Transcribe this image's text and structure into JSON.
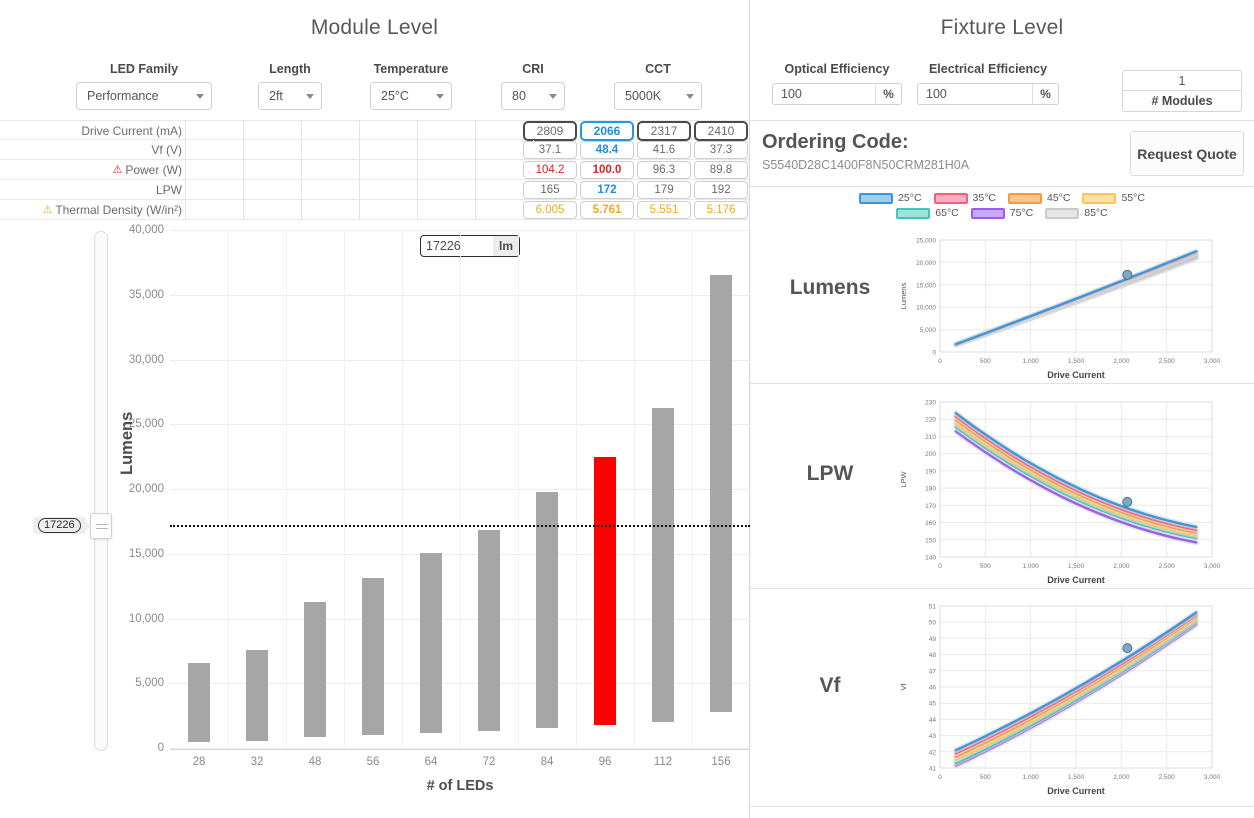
{
  "module": {
    "title": "Module Level",
    "selectors": [
      {
        "name": "led-family",
        "label": "LED Family",
        "value": "Performance"
      },
      {
        "name": "length",
        "label": "Length",
        "value": "2ft"
      },
      {
        "name": "temperature",
        "label": "Temperature",
        "value": "25°C"
      },
      {
        "name": "cri",
        "label": "CRI",
        "value": "80"
      },
      {
        "name": "cct",
        "label": "CCT",
        "value": "5000K"
      }
    ],
    "table": {
      "rows": [
        {
          "label": "Drive Current (mA)",
          "warn": null,
          "values": [
            "2809",
            "2066",
            "2317",
            "2410"
          ]
        },
        {
          "label": "Vf (V)",
          "warn": null,
          "values": [
            "37.1",
            "48.4",
            "41.6",
            "37.3"
          ]
        },
        {
          "label": "Power (W)",
          "warn": "red",
          "values": [
            "104.2",
            "100.0",
            "96.3",
            "89.8"
          ]
        },
        {
          "label": "LPW",
          "warn": null,
          "values": [
            "165",
            "172",
            "179",
            "192"
          ]
        },
        {
          "label": "Thermal Density (W/in²)",
          "warn": "orange",
          "values": [
            "6.005",
            "5.761",
            "5.551",
            "5.176"
          ]
        }
      ],
      "selected_column": 1
    },
    "slider": {
      "value": "17226"
    },
    "lumen_input": {
      "value": "17226",
      "unit": "lm"
    }
  },
  "fixture": {
    "title": "Fixture Level",
    "optical_efficiency": {
      "label": "Optical Efficiency",
      "value": "100",
      "unit": "%"
    },
    "electrical_efficiency": {
      "label": "Electrical Efficiency",
      "value": "100",
      "unit": "%"
    },
    "modules": {
      "value": "1",
      "label": "# Modules"
    },
    "ordering": {
      "title": "Ordering Code:",
      "code": "S5540D28C1400F8N50CRM281H0A"
    },
    "quote_button": "Request Quote",
    "legend": [
      {
        "label": "25°C",
        "color": "#3a97dd",
        "fill": "#9ccef2"
      },
      {
        "label": "35°C",
        "color": "#f2607f",
        "fill": "#f9afc0"
      },
      {
        "label": "45°C",
        "color": "#f79a3c",
        "fill": "#fbc68b"
      },
      {
        "label": "55°C",
        "color": "#fbc55c",
        "fill": "#fde0a4"
      },
      {
        "label": "65°C",
        "color": "#45c4b6",
        "fill": "#9fe2da"
      },
      {
        "label": "75°C",
        "color": "#9a5df0",
        "fill": "#c9a7f7"
      },
      {
        "label": "85°C",
        "color": "#c9c9c9",
        "fill": "#e6e6e6"
      }
    ]
  },
  "chart_data": [
    {
      "type": "bar",
      "name": "module-lumens-range",
      "title": "",
      "xlabel": "# of LEDs",
      "ylabel": "Lumens",
      "ylim": [
        0,
        40000
      ],
      "yticks": [
        0,
        5000,
        10000,
        15000,
        20000,
        25000,
        30000,
        35000,
        40000
      ],
      "categories": [
        "28",
        "32",
        "48",
        "56",
        "64",
        "72",
        "84",
        "96",
        "112",
        "156"
      ],
      "series": [
        {
          "name": "min",
          "values": [
            500,
            560,
            870,
            1000,
            1150,
            1280,
            1530,
            1770,
            2030,
            2790
          ]
        },
        {
          "name": "max",
          "values": [
            6600,
            7550,
            11250,
            13150,
            15050,
            16800,
            19750,
            22500,
            26250,
            36550
          ]
        }
      ],
      "highlight_category": "96",
      "highlight_color": "#fe0000",
      "bar_color": "#a6a6a6",
      "threshold": {
        "value": 17226,
        "style": "dotted",
        "color": "#111111"
      },
      "grid": true,
      "legend": "none"
    },
    {
      "type": "line",
      "name": "fixture-lumens-vs-drive-current",
      "title": "Lumens",
      "xlabel": "Drive Current",
      "ylabel": "Lumens",
      "xlim": [
        0,
        3000
      ],
      "ylim": [
        0,
        25000
      ],
      "xticks": [
        0,
        500,
        1000,
        1500,
        2000,
        2500,
        3000
      ],
      "yticks": [
        0,
        5000,
        10000,
        15000,
        20000,
        25000
      ],
      "x": [
        175,
        2825
      ],
      "series": [
        {
          "name": "25°C",
          "values": [
            1720,
            22450
          ]
        },
        {
          "name": "35°C",
          "values": [
            1705,
            22200
          ]
        },
        {
          "name": "45°C",
          "values": [
            1690,
            21950
          ]
        },
        {
          "name": "55°C",
          "values": [
            1675,
            21700
          ]
        },
        {
          "name": "65°C",
          "values": [
            1660,
            21450
          ]
        },
        {
          "name": "75°C",
          "values": [
            1645,
            21200
          ]
        },
        {
          "name": "85°C",
          "values": [
            1630,
            20950
          ]
        }
      ],
      "marker": {
        "x": 2066,
        "y": 17226
      },
      "grid": true,
      "legend": "top-shared"
    },
    {
      "type": "line",
      "name": "fixture-lpw-vs-drive-current",
      "title": "LPW",
      "xlabel": "Drive Current",
      "ylabel": "LPW",
      "xlim": [
        0,
        3000
      ],
      "ylim": [
        140,
        230
      ],
      "xticks": [
        0,
        500,
        1000,
        1500,
        2000,
        2500,
        3000
      ],
      "yticks": [
        140,
        150,
        160,
        170,
        180,
        190,
        200,
        210,
        220,
        230
      ],
      "x": [
        175,
        2825
      ],
      "series": [
        {
          "name": "25°C",
          "values": [
            223.5,
            157.5
          ]
        },
        {
          "name": "35°C",
          "values": [
            221.5,
            155.8
          ]
        },
        {
          "name": "45°C",
          "values": [
            219.5,
            154.2
          ]
        },
        {
          "name": "55°C",
          "values": [
            217.5,
            152.6
          ]
        },
        {
          "name": "65°C",
          "values": [
            215.5,
            151.0
          ]
        },
        {
          "name": "75°C",
          "values": [
            213.0,
            148.5
          ]
        }
      ],
      "marker": {
        "x": 2066,
        "y": 172
      },
      "grid": true,
      "legend": "top-shared"
    },
    {
      "type": "line",
      "name": "fixture-vf-vs-drive-current",
      "title": "Vf",
      "xlabel": "Drive Current",
      "ylabel": "Vf",
      "xlim": [
        0,
        3000
      ],
      "ylim": [
        41,
        51
      ],
      "xticks": [
        0,
        500,
        1000,
        1500,
        2000,
        2500,
        3000
      ],
      "yticks": [
        41,
        42,
        43,
        44,
        45,
        46,
        47,
        48,
        49,
        50,
        51
      ],
      "x": [
        175,
        2825
      ],
      "series": [
        {
          "name": "25°C",
          "values": [
            42.1,
            50.6
          ]
        },
        {
          "name": "35°C",
          "values": [
            41.9,
            50.45
          ]
        },
        {
          "name": "45°C",
          "values": [
            41.7,
            50.3
          ]
        },
        {
          "name": "55°C",
          "values": [
            41.5,
            50.15
          ]
        },
        {
          "name": "65°C",
          "values": [
            41.3,
            50.0
          ]
        },
        {
          "name": "75°C",
          "values": [
            41.15,
            49.85
          ]
        }
      ],
      "marker": {
        "x": 2066,
        "y": 48.4
      },
      "grid": true,
      "legend": "top-shared"
    }
  ]
}
